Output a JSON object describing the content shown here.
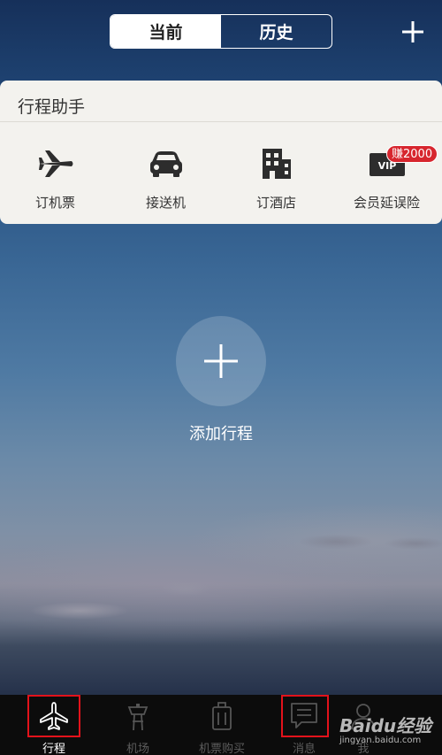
{
  "header": {
    "tabs": [
      {
        "label": "当前",
        "active": true
      },
      {
        "label": "历史",
        "active": false
      }
    ],
    "add_icon": "plus-icon"
  },
  "assistant": {
    "title": "行程助手",
    "tools": [
      {
        "label": "订机票",
        "icon": "airplane-icon"
      },
      {
        "label": "接送机",
        "icon": "car-icon"
      },
      {
        "label": "订酒店",
        "icon": "hotel-building-icon"
      },
      {
        "label": "会员延误险",
        "icon": "vip-card-icon"
      }
    ],
    "badge": "赚2000"
  },
  "main": {
    "add_trip_label": "添加行程"
  },
  "tabbar": {
    "items": [
      {
        "label": "行程",
        "icon": "airplane-icon",
        "active": true
      },
      {
        "label": "机场",
        "icon": "control-tower-icon",
        "active": false
      },
      {
        "label": "机票购买",
        "icon": "luggage-icon",
        "active": false
      },
      {
        "label": "消息",
        "icon": "message-icon",
        "active": false
      },
      {
        "label": "我",
        "icon": "user-icon",
        "active": false
      }
    ]
  },
  "watermark": {
    "main": "Baidu经验",
    "sub": "jingyan.baidu.com"
  },
  "colors": {
    "highlight_box": "#e3121b",
    "badge": "#d7262e",
    "card_bg": "#f3f2ee",
    "tabbar_bg": "#0c0c0c"
  }
}
